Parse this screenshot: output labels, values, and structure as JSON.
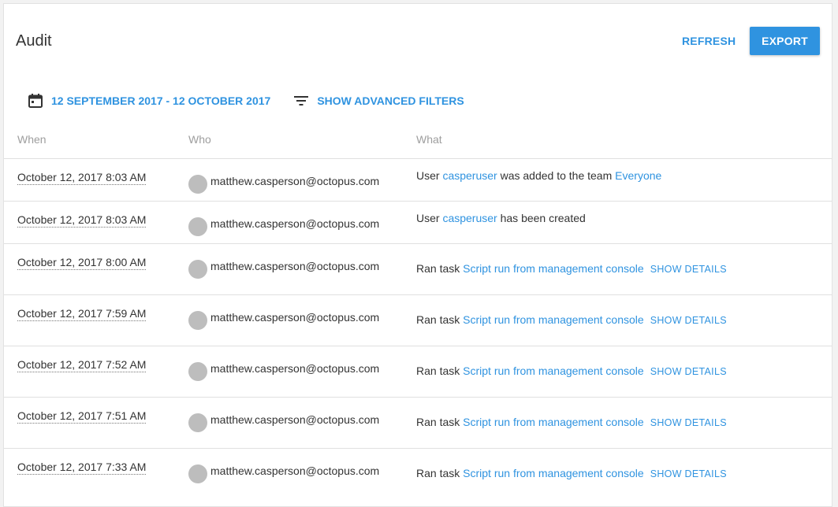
{
  "header": {
    "title": "Audit",
    "refresh_label": "REFRESH",
    "export_label": "EXPORT"
  },
  "filters": {
    "date_range": "12 SEPTEMBER 2017 - 12 OCTOBER 2017",
    "advanced_label": "SHOW ADVANCED FILTERS",
    "calendar_icon": "calendar-icon",
    "filter_icon": "filter-list-icon"
  },
  "columns": {
    "when": "When",
    "who": "Who",
    "what": "What"
  },
  "colors": {
    "accent": "#2f93e0",
    "avatar": "#bdbdbd"
  },
  "rows": [
    {
      "when": "October 12, 2017 8:03 AM",
      "who": "matthew.casperson@octopus.com",
      "what": {
        "prefix": "User ",
        "link1": "casperuser",
        "middle": " was added to the team ",
        "link2": "Everyone",
        "details": ""
      }
    },
    {
      "when": "October 12, 2017 8:03 AM",
      "who": "matthew.casperson@octopus.com",
      "what": {
        "prefix": "User ",
        "link1": "casperuser",
        "middle": " has been created",
        "link2": "",
        "details": ""
      }
    },
    {
      "when": "October 12, 2017 8:00 AM",
      "who": "matthew.casperson@octopus.com",
      "what": {
        "prefix": "Ran task ",
        "link1": "Script run from management console",
        "middle": "",
        "link2": "",
        "details": "SHOW DETAILS"
      }
    },
    {
      "when": "October 12, 2017 7:59 AM",
      "who": "matthew.casperson@octopus.com",
      "what": {
        "prefix": "Ran task ",
        "link1": "Script run from management console",
        "middle": "",
        "link2": "",
        "details": "SHOW DETAILS"
      }
    },
    {
      "when": "October 12, 2017 7:52 AM",
      "who": "matthew.casperson@octopus.com",
      "what": {
        "prefix": "Ran task ",
        "link1": "Script run from management console",
        "middle": "",
        "link2": "",
        "details": "SHOW DETAILS"
      }
    },
    {
      "when": "October 12, 2017 7:51 AM",
      "who": "matthew.casperson@octopus.com",
      "what": {
        "prefix": "Ran task ",
        "link1": "Script run from management console",
        "middle": "",
        "link2": "",
        "details": "SHOW DETAILS"
      }
    },
    {
      "when": "October 12, 2017 7:33 AM",
      "who": "matthew.casperson@octopus.com",
      "what": {
        "prefix": "Ran task ",
        "link1": "Script run from management console",
        "middle": "",
        "link2": "",
        "details": "SHOW DETAILS"
      }
    }
  ]
}
